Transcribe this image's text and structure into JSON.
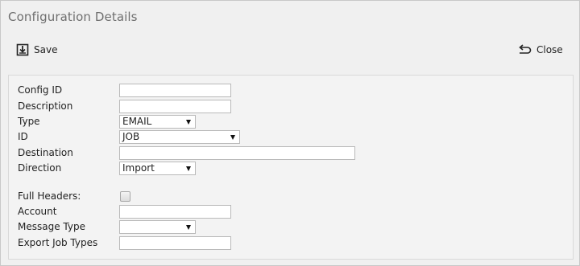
{
  "window": {
    "title": "Configuration Details"
  },
  "toolbar": {
    "save_icon": "save-icon",
    "save_label": "Save",
    "close_icon": "undo-arrow-icon",
    "close_label": "Close"
  },
  "form": {
    "config_id": {
      "label": "Config ID",
      "value": ""
    },
    "description": {
      "label": "Description",
      "value": ""
    },
    "type": {
      "label": "Type",
      "value": "EMAIL"
    },
    "id": {
      "label": "ID",
      "value": "JOB"
    },
    "destination": {
      "label": "Destination",
      "value": ""
    },
    "direction": {
      "label": "Direction",
      "value": "Import"
    },
    "full_headers": {
      "label": "Full Headers:",
      "checked": false
    },
    "account": {
      "label": "Account",
      "value": ""
    },
    "message_type": {
      "label": "Message Type",
      "value": ""
    },
    "export_job_types": {
      "label": "Export Job Types",
      "value": ""
    }
  }
}
